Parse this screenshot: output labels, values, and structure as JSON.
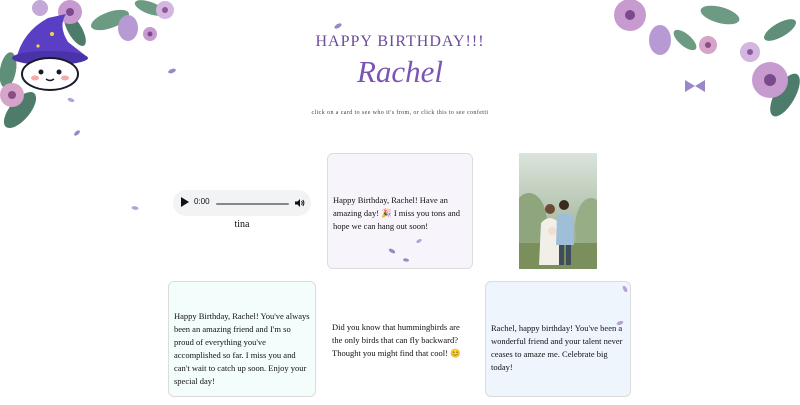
{
  "header": {
    "greeting": "HAPPY BIRTHDAY!!!",
    "recipient": "Rachel",
    "hint": "click on a card to see who it's from, or click this to see confetti"
  },
  "audio": {
    "time": "0:00",
    "progress": 0,
    "from": "tina"
  },
  "cards": [
    {
      "message": "Happy Birthday, Rachel! Have an amazing day! 🎉 I miss you tons and hope we can hang out soon!",
      "background": "#f7f5fb"
    },
    {
      "message": "Happy Birthday, Rachel! You've always been an amazing friend and I'm so proud of everything you've accomplished so far. I miss you and can't wait to catch up soon. Enjoy your special day!",
      "background": "#f3fdfc"
    },
    {
      "message": "Did you know that hummingbirds are the only birds that can fly backward? Thought you might find that cool! 😊",
      "background": "#ffffff"
    },
    {
      "message": "Rachel, happy birthday! You've been a wonderful friend and your talent never ceases to amaze me. Celebrate big today!",
      "background": "#eef5fd"
    }
  ],
  "colors": {
    "accent": "#7a55b2",
    "petal": "#9a86c8",
    "leaf": "#4d7d6a"
  },
  "icons": {
    "play": "play-icon",
    "volume": "volume-icon"
  }
}
